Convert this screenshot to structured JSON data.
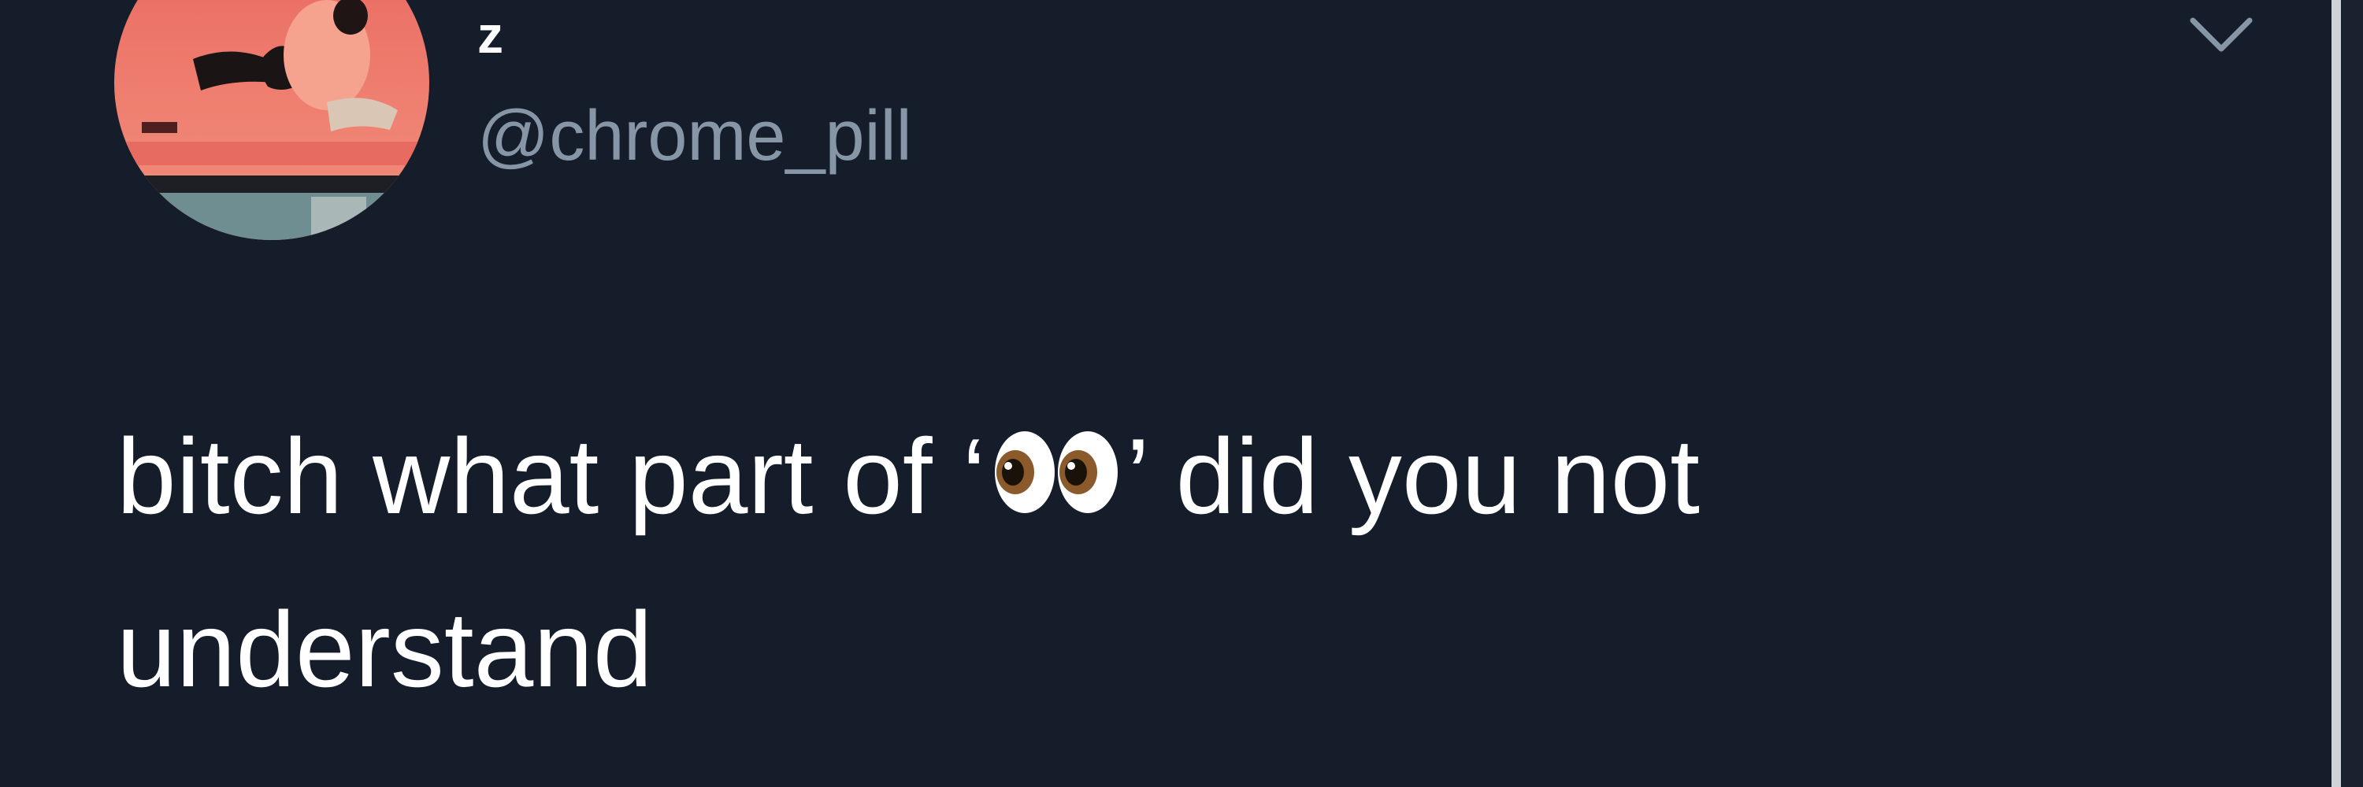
{
  "tweet": {
    "display_name": "z",
    "handle": "@chrome_pill",
    "text_line1_before": "bitch what part of ‘",
    "text_line1_emoji": "eyes-emoji",
    "text_line1_after": "’ did you not",
    "text_line2": "understand"
  },
  "icons": {
    "menu": "chevron-down-icon",
    "emoji": "eyes-emoji"
  },
  "colors": {
    "background": "#161d2a",
    "display_name": "#ffffff",
    "handle": "#8796a7",
    "body_text": "#ffffff",
    "chevron": "#8796a7"
  }
}
